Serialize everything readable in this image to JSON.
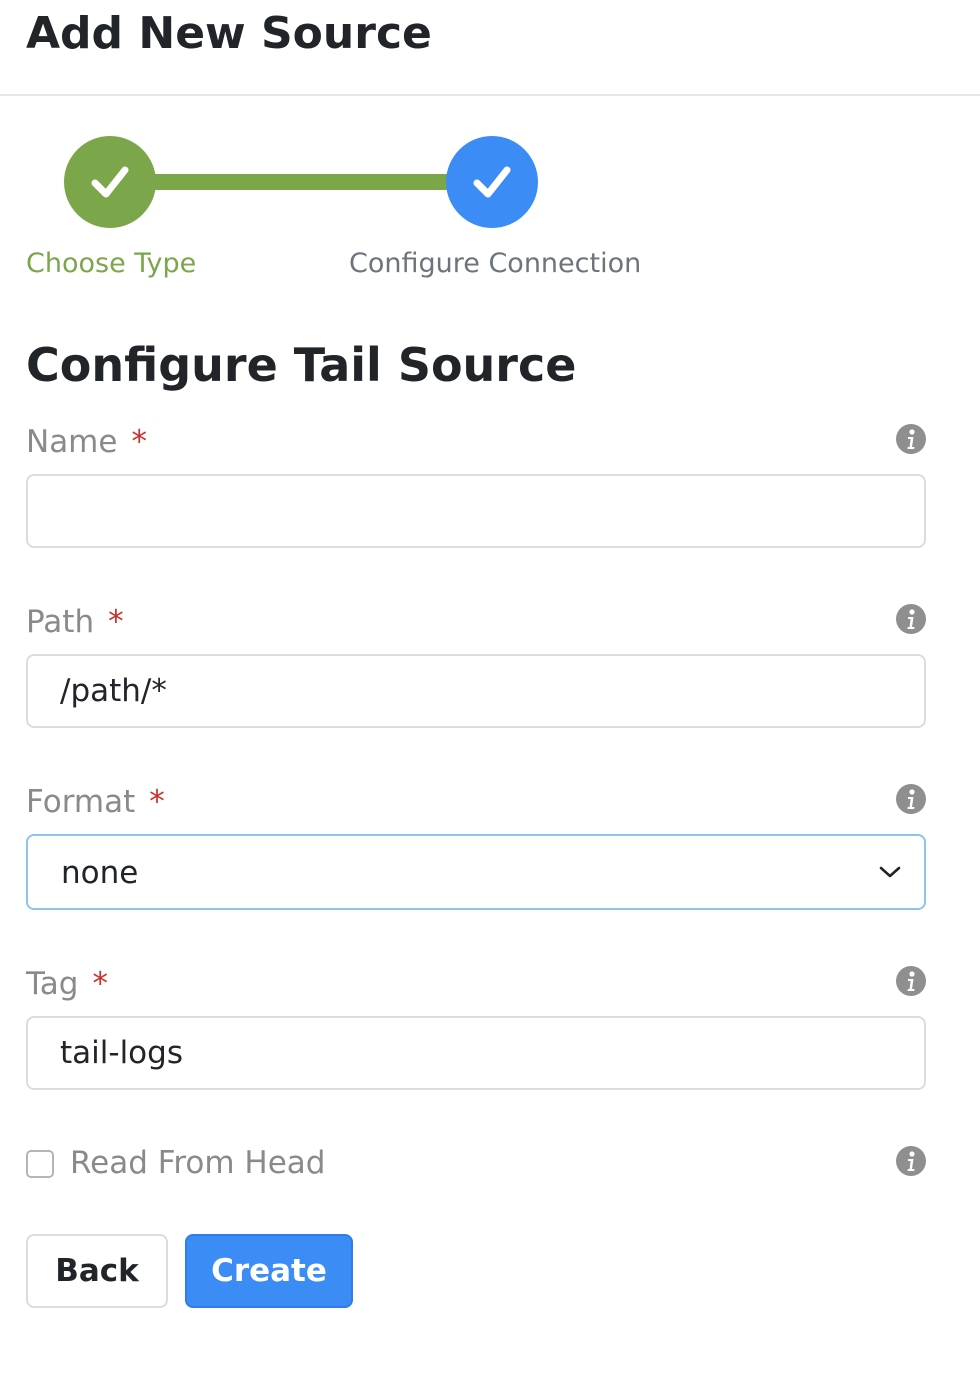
{
  "header": {
    "title": "Add New Source"
  },
  "stepper": {
    "steps": [
      {
        "label": "Choose Type",
        "status": "complete",
        "color": "#7ca64a",
        "icon": "checkmark-icon"
      },
      {
        "label": "Configure Connection",
        "status": "current",
        "color": "#3b8cf5",
        "icon": "checkmark-icon"
      }
    ]
  },
  "form": {
    "title": "Configure Tail Source",
    "required_marker": "*",
    "fields": {
      "name": {
        "label": "Name",
        "value": "",
        "placeholder": ""
      },
      "path": {
        "label": "Path",
        "value": "/path/*"
      },
      "format": {
        "label": "Format",
        "value": "none"
      },
      "tag": {
        "label": "Tag",
        "value": "tail-logs"
      },
      "read_from_head": {
        "label": "Read From Head",
        "checked": false
      }
    }
  },
  "actions": {
    "back_label": "Back",
    "create_label": "Create"
  },
  "colors": {
    "accent": "#3b8cf5",
    "success": "#7ca64a",
    "required": "#c9302c",
    "label": "#8a8a8a"
  }
}
